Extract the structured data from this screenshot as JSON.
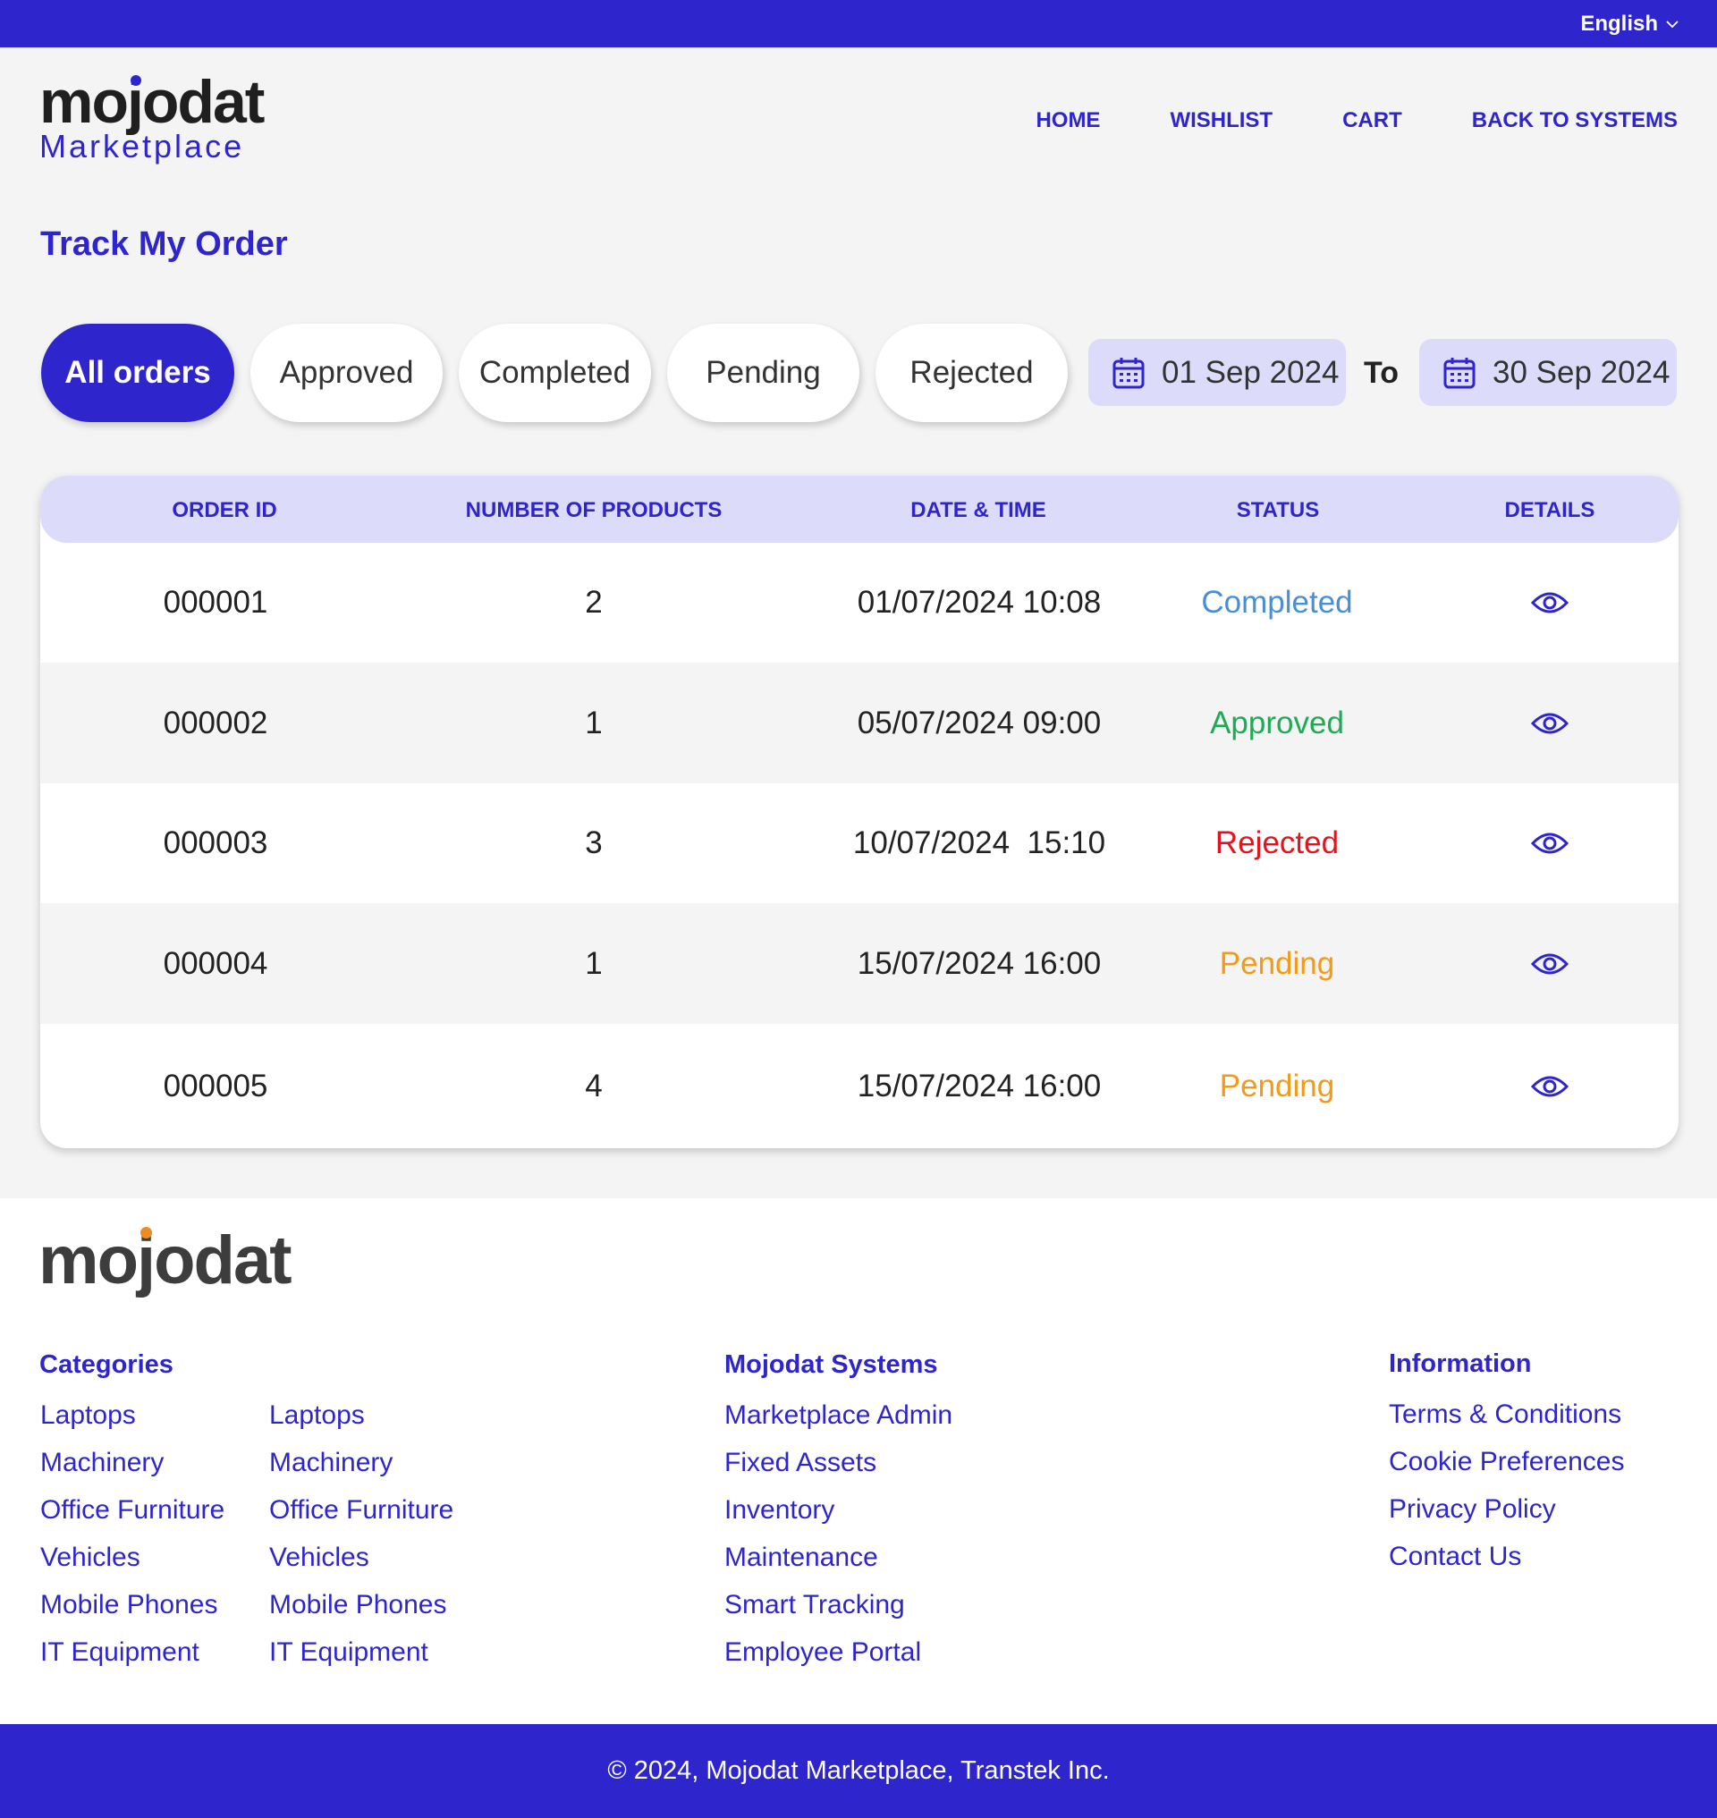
{
  "topbar": {
    "language": "English"
  },
  "brand": {
    "logo_text": "mojodat",
    "logo_subtitle": "Marketplace"
  },
  "nav": {
    "items": [
      "HOME",
      "WISHLIST",
      "CART",
      "BACK TO SYSTEMS"
    ]
  },
  "page": {
    "title": "Track My Order"
  },
  "filters": {
    "tabs": [
      "All orders",
      "Approved",
      "Completed",
      "Pending",
      "Rejected"
    ],
    "active": "All orders",
    "date_from": "01 Sep 2024",
    "to_label": "To",
    "date_to": "30 Sep 2024"
  },
  "table": {
    "headers": [
      "ORDER ID",
      "NUMBER OF PRODUCTS",
      "DATE & TIME",
      "STATUS",
      "DETAILS"
    ],
    "rows": [
      {
        "order_id": "000001",
        "products": "2",
        "datetime": "01/07/2024 10:08",
        "status": "Completed"
      },
      {
        "order_id": "000002",
        "products": "1",
        "datetime": "05/07/2024 09:00",
        "status": "Approved"
      },
      {
        "order_id": "000003",
        "products": "3",
        "datetime": "10/07/2024  15:10",
        "status": "Rejected"
      },
      {
        "order_id": "000004",
        "products": "1",
        "datetime": "15/07/2024 16:00",
        "status": "Pending"
      },
      {
        "order_id": "000005",
        "products": "4",
        "datetime": "15/07/2024 16:00",
        "status": "Pending"
      }
    ],
    "details_icon": "eye-icon"
  },
  "status_colors": {
    "Completed": "#4a8fd6",
    "Approved": "#1faa55",
    "Rejected": "#e8121e",
    "Pending": "#f29a1a"
  },
  "colors": {
    "primary": "#2e25cc",
    "header_bg": "#dcdcfa",
    "footer_logo_dot": "#f08a24"
  },
  "footer": {
    "logo_text": "mojodat",
    "categories": {
      "title": "Categories",
      "col1": [
        "Laptops",
        "Machinery",
        "Office Furniture",
        "Vehicles",
        "Mobile Phones",
        "IT Equipment"
      ],
      "col2": [
        "Laptops",
        "Machinery",
        "Office Furniture",
        "Vehicles",
        "Mobile Phones",
        "IT Equipment"
      ]
    },
    "systems": {
      "title": "Mojodat Systems",
      "items": [
        "Marketplace Admin",
        "Fixed Assets",
        "Inventory",
        "Maintenance",
        "Smart Tracking",
        "Employee Portal"
      ]
    },
    "information": {
      "title": "Information",
      "items": [
        "Terms & Conditions",
        "Cookie Preferences",
        "Privacy Policy",
        "Contact Us"
      ]
    },
    "copyright": "© 2024, Mojodat Marketplace, Transtek Inc."
  }
}
